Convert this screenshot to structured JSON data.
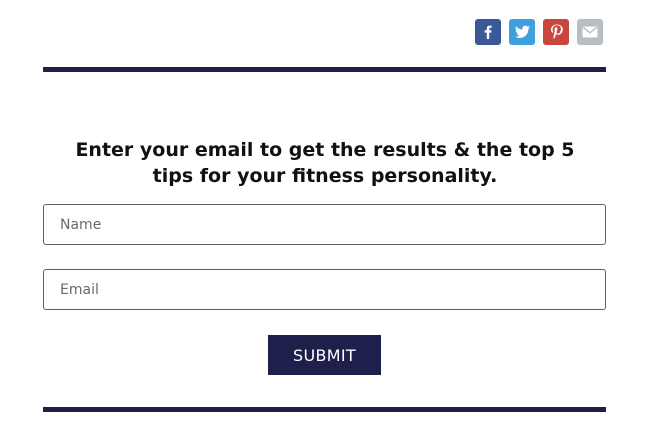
{
  "share": {
    "buttons": [
      {
        "icon": "facebook-icon",
        "color": "#3b5998"
      },
      {
        "icon": "twitter-icon",
        "color": "#3ea0df"
      },
      {
        "icon": "pinterest-icon",
        "color": "#c8463d"
      },
      {
        "icon": "email-icon",
        "color": "#b7bec2"
      }
    ]
  },
  "colors": {
    "accent": "#1f1f4b",
    "heading": "#111111",
    "border": "#5f5f5f"
  },
  "form": {
    "heading": "Enter your email to get the results & the top 5 tips for your fitness personality.",
    "name_placeholder": "Name",
    "name_value": "",
    "email_placeholder": "Email",
    "email_value": "",
    "submit_label": "SUBMIT"
  }
}
